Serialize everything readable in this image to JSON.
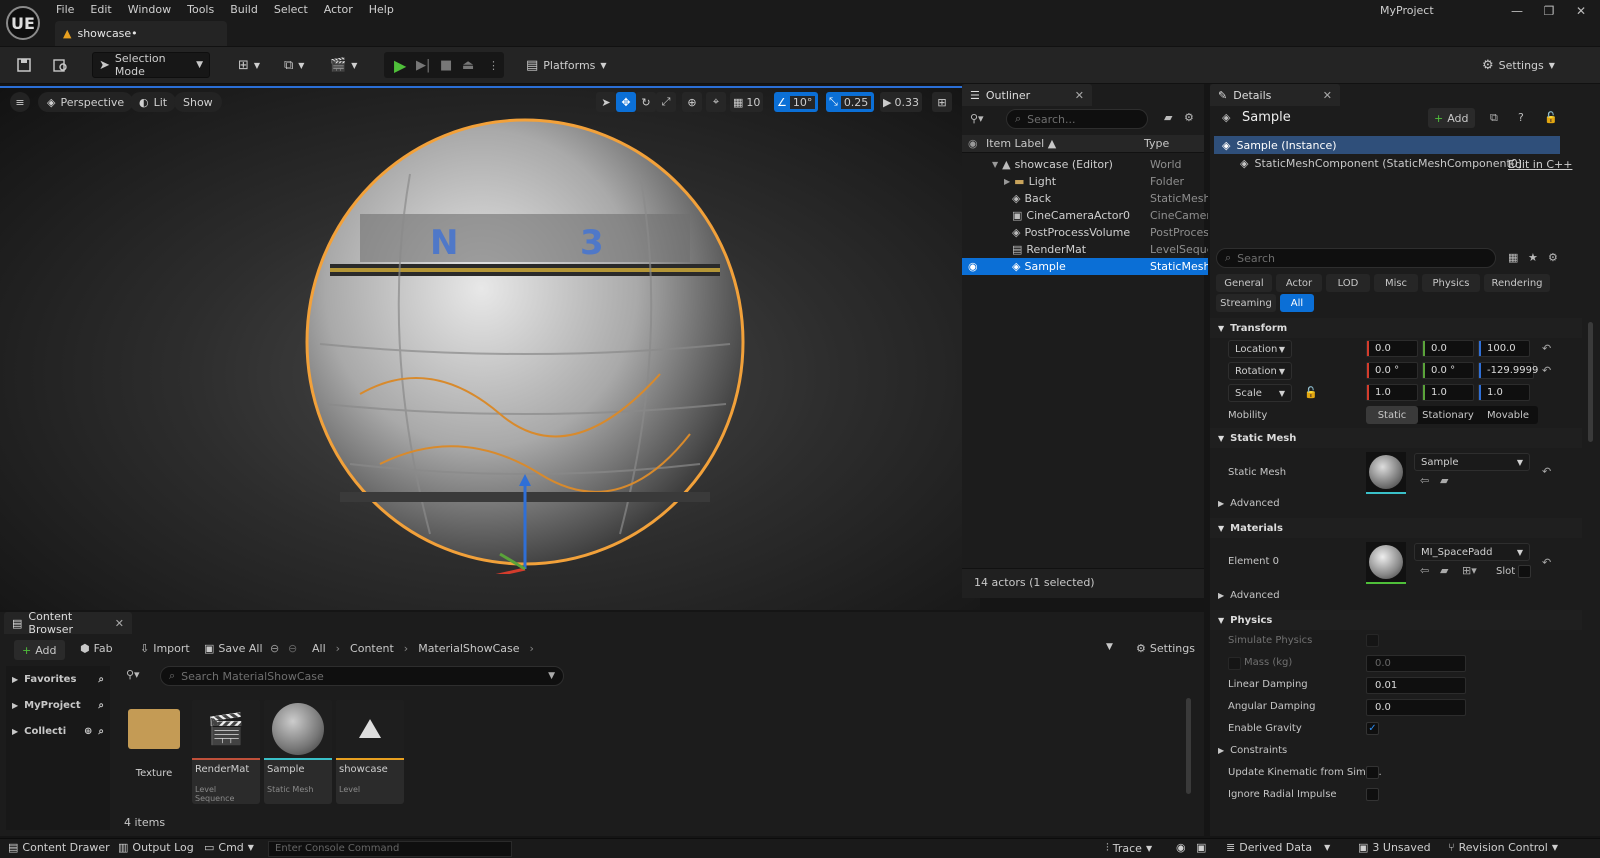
{
  "app": {
    "logo": "UE",
    "project_name": "MyProject",
    "menu": [
      "File",
      "Edit",
      "Window",
      "Tools",
      "Build",
      "Select",
      "Actor",
      "Help"
    ],
    "document_tab": "showcase•"
  },
  "toolbar": {
    "selection_mode": "Selection Mode",
    "platforms": "Platforms",
    "settings": "Settings"
  },
  "viewport": {
    "perspective": "Perspective",
    "lit": "Lit",
    "show": "Show",
    "grid_snap": "10",
    "rotation_snap": "10°",
    "scale_snap": "0.25",
    "camera_speed": "0.33"
  },
  "outliner": {
    "tab": "Outliner",
    "search_placeholder": "Search...",
    "col_label": "Item Label ▲",
    "col_type": "Type",
    "rows": [
      {
        "label": "showcase (Editor)",
        "type": "World"
      },
      {
        "label": "Light",
        "type": "Folder"
      },
      {
        "label": "Back",
        "type": "StaticMeshActor"
      },
      {
        "label": "CineCameraActor0",
        "type": "CineCameraActor"
      },
      {
        "label": "PostProcessVolume",
        "type": "PostProcessVolume"
      },
      {
        "label": "RenderMat",
        "type": "LevelSequenceActor"
      },
      {
        "label": "Sample",
        "type": "StaticMeshActor"
      }
    ],
    "footer": "14 actors (1 selected)"
  },
  "details": {
    "tab": "Details",
    "actor_name": "Sample",
    "add": "Add",
    "instance": "Sample (Instance)",
    "component": "StaticMeshComponent (StaticMeshComponent0)",
    "edit_cpp": "Edit in C++",
    "search_placeholder": "Search",
    "categories": [
      "General",
      "Actor",
      "LOD",
      "Misc",
      "Physics",
      "Rendering",
      "Streaming",
      "All"
    ],
    "transform": {
      "title": "Transform",
      "location_label": "Location",
      "rotation_label": "Rotation",
      "scale_label": "Scale",
      "location": [
        "0.0",
        "0.0",
        "100.0"
      ],
      "rotation": [
        "0.0 °",
        "0.0 °",
        "-129.9999"
      ],
      "scale": [
        "1.0",
        "1.0",
        "1.0"
      ],
      "mobility_label": "Mobility",
      "mobility": [
        "Static",
        "Stationary",
        "Movable"
      ]
    },
    "static_mesh": {
      "title": "Static Mesh",
      "label": "Static Mesh",
      "value": "Sample",
      "advanced": "Advanced"
    },
    "materials": {
      "title": "Materials",
      "element_label": "Element 0",
      "value": "MI_SpacePadd",
      "slot": "Slot",
      "advanced": "Advanced"
    },
    "physics": {
      "title": "Physics",
      "simulate": "Simulate Physics",
      "mass_label": "Mass (kg)",
      "mass_value": "0.0",
      "linear_damping_label": "Linear Damping",
      "linear_damping": "0.01",
      "angular_damping_label": "Angular Damping",
      "angular_damping": "0.0",
      "gravity_label": "Enable Gravity",
      "constraints": "Constraints",
      "update_kinematic": "Update Kinematic from Simu...",
      "ignore_radial": "Ignore Radial Impulse"
    }
  },
  "content_browser": {
    "tab": "Content Browser",
    "add": "Add",
    "fab": "Fab",
    "import": "Import",
    "save_all": "Save All",
    "path": [
      "All",
      "Content",
      "MaterialShowCase"
    ],
    "settings": "Settings",
    "sidebar": [
      "Favorites",
      "MyProject",
      "Collecti"
    ],
    "search_placeholder": "Search MaterialShowCase",
    "assets": [
      {
        "name": "Texture",
        "type": ""
      },
      {
        "name": "RenderMat",
        "type": "Level Sequence"
      },
      {
        "name": "Sample",
        "type": "Static Mesh"
      },
      {
        "name": "showcase",
        "type": "Level"
      }
    ],
    "count": "4 items"
  },
  "statusbar": {
    "content_drawer": "Content Drawer",
    "output_log": "Output Log",
    "cmd": "Cmd",
    "console_placeholder": "Enter Console Command",
    "trace": "Trace",
    "derived_data": "Derived Data",
    "unsaved": "3 Unsaved",
    "revision_control": "Revision Control"
  },
  "colors": {
    "accent": "#0b6fd6",
    "play_green": "#4fbf3a",
    "x_axis": "#d43c2c",
    "y_axis": "#5aa33a",
    "z_axis": "#2f6fd6",
    "selection_outline": "#f2a13a"
  }
}
